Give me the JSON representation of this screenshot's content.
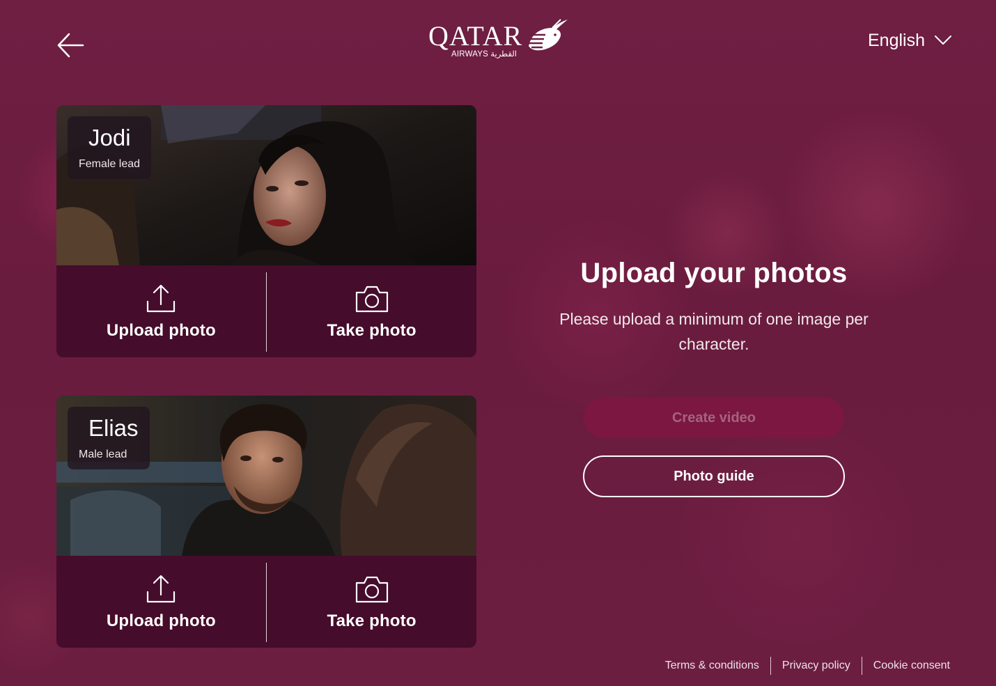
{
  "header": {
    "back_icon": "arrow-left-icon",
    "logo": {
      "word": "QATAR",
      "sub": "AIRWAYS القطرية",
      "icon": "oryx-logo-icon"
    },
    "language": {
      "label": "English",
      "icon": "chevron-down-icon"
    }
  },
  "characters": [
    {
      "name": "Jodi",
      "role": "Female lead",
      "upload_label": "Upload photo",
      "take_label": "Take photo",
      "upload_icon": "upload-icon",
      "take_icon": "camera-icon"
    },
    {
      "name": "Elias",
      "role": "Male lead",
      "upload_label": "Upload photo",
      "take_label": "Take photo",
      "upload_icon": "upload-icon",
      "take_icon": "camera-icon"
    }
  ],
  "main": {
    "title": "Upload your photos",
    "description": "Please upload a minimum of one image per character.",
    "create_video_label": "Create video",
    "photo_guide_label": "Photo guide"
  },
  "footer": {
    "links": [
      "Terms & conditions",
      "Privacy policy",
      "Cookie consent"
    ]
  },
  "colors": {
    "background": "#6c1e41",
    "card": "#450c2b",
    "create_button_disabled": "#7b1740"
  }
}
